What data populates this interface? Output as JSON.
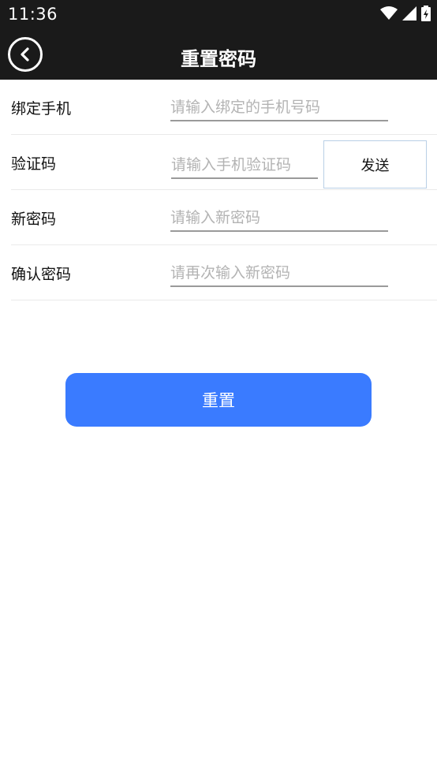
{
  "status_bar": {
    "time": "11:36",
    "icons": [
      "wifi-icon",
      "signal-icon",
      "battery-charging-icon"
    ]
  },
  "app_bar": {
    "title": "重置密码",
    "back_icon": "back-chevron-icon"
  },
  "form": {
    "phone": {
      "label": "绑定手机",
      "placeholder": "请输入绑定的手机号码",
      "value": ""
    },
    "code": {
      "label": "验证码",
      "placeholder": "请输入手机验证码",
      "value": "",
      "send_label": "发送"
    },
    "new_password": {
      "label": "新密码",
      "placeholder": "请输入新密码",
      "value": ""
    },
    "confirm_password": {
      "label": "确认密码",
      "placeholder": "请再次输入新密码",
      "value": ""
    }
  },
  "reset_button": {
    "label": "重置"
  },
  "colors": {
    "bar_bg": "#1a1a1a",
    "accent": "#3a7bff",
    "placeholder": "#b3b3b3",
    "divider": "#eaeaea"
  }
}
